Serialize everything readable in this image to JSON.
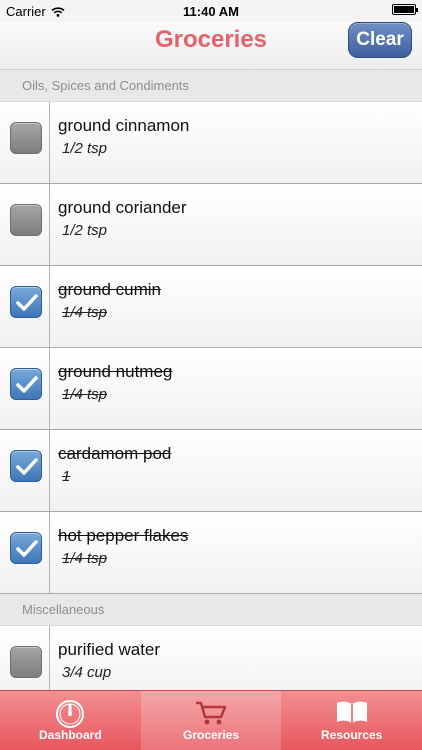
{
  "status_bar": {
    "carrier": "Carrier",
    "time": "11:40 AM",
    "battery_level": 1.0
  },
  "header": {
    "title": "Groceries",
    "clear_label": "Clear"
  },
  "sections": [
    {
      "title": "Oils, Spices and Condiments",
      "items": [
        {
          "name": "ground cinnamon",
          "qty": "1/2 tsp",
          "checked": false
        },
        {
          "name": "ground coriander",
          "qty": "1/2 tsp",
          "checked": false
        },
        {
          "name": "ground cumin",
          "qty": "1/4 tsp",
          "checked": true
        },
        {
          "name": "ground nutmeg",
          "qty": "1/4 tsp",
          "checked": true
        },
        {
          "name": "cardamom pod",
          "qty": "1",
          "checked": true
        },
        {
          "name": "hot pepper flakes",
          "qty": "1/4 tsp",
          "checked": true
        }
      ]
    },
    {
      "title": "Miscellaneous",
      "items": [
        {
          "name": "purified water",
          "qty": "3/4 cup",
          "checked": false
        }
      ]
    }
  ],
  "tabs": [
    {
      "label": "Dashboard",
      "icon": "gauge-icon",
      "active": false
    },
    {
      "label": "Groceries",
      "icon": "cart-icon",
      "active": true
    },
    {
      "label": "Resources",
      "icon": "book-icon",
      "active": false
    }
  ],
  "colors": {
    "title": "#e4636a",
    "clear_button": "#4f70ab",
    "tab_bar": "#e9676c",
    "checked": "#4a82c0",
    "unchecked": "#8c8c8c"
  }
}
